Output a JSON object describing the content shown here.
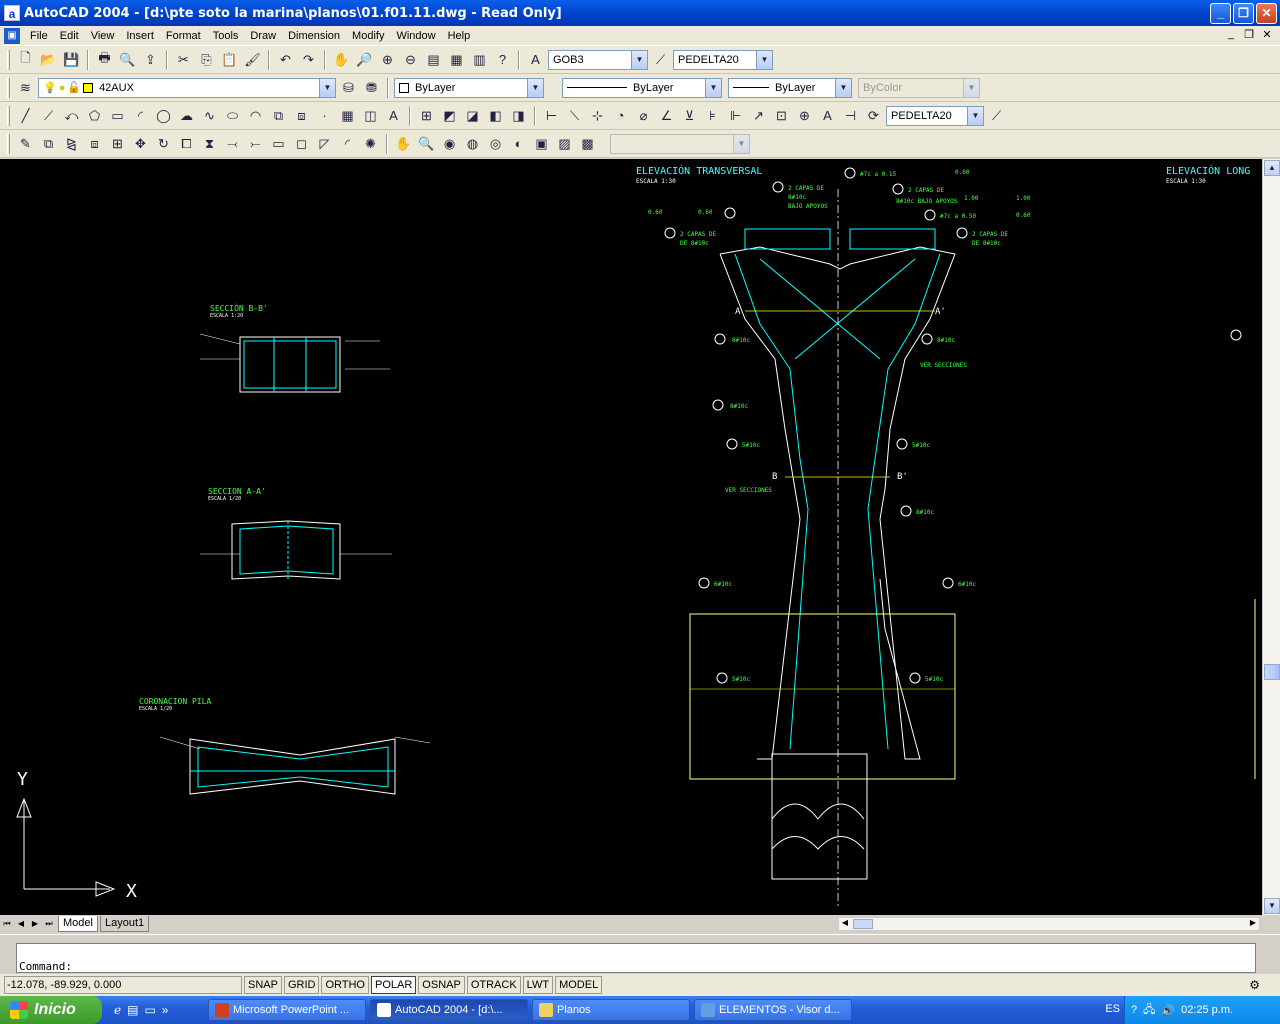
{
  "window": {
    "title": "AutoCAD 2004 - [d:\\pte soto la marina\\planos\\01.f01.11.dwg - Read Only]",
    "app_icon": "a",
    "minimize": "_",
    "maximize": "❐",
    "close": "✕"
  },
  "menu": {
    "items": [
      "File",
      "Edit",
      "View",
      "Insert",
      "Format",
      "Tools",
      "Draw",
      "Dimension",
      "Modify",
      "Window",
      "Help"
    ]
  },
  "toolbar1": {
    "text_style": "GOB3",
    "dim_style": "PEDELTA20"
  },
  "toolbar2": {
    "layer": "42AUX",
    "color": "ByLayer",
    "linetype": "ByLayer",
    "lineweight": "ByLayer",
    "plotstyle": "ByColor"
  },
  "toolbar3": {
    "dim_style": "PEDELTA20"
  },
  "drawing": {
    "elev_trans_title": "ELEVACIÓN TRANSVERSAL",
    "elev_trans_scale": "ESCALA 1:30",
    "elev_long_title": "ELEVACIÓN LONG",
    "elev_long_scale": "ESCALA 1:30",
    "sec_bb_title": "SECCIÓN B-B'",
    "sec_bb_scale": "ESCALA 1:20",
    "sec_aa_title": "SECCION A-A'",
    "sec_aa_scale": "ESCALA 1/20",
    "coron_title": "CORONACION PILA",
    "coron_scale": "ESCALA 1/20",
    "label_a": "A",
    "label_a2": "A'",
    "label_b": "B",
    "label_b2": "B'",
    "ver_secciones": "VER SECCIONES",
    "callouts_left": [
      "2 CAPAS DE",
      "DE 8#10c",
      "8#10c",
      "8#10c",
      "5#10c",
      "6#10c",
      "5#10c"
    ],
    "callouts_right": [
      "2 CAPAS DE",
      "DE 8#10c",
      "8#10c",
      "5#10c",
      "8#10c",
      "6#10c",
      "5#10c"
    ],
    "top_notes": [
      "#7c a 0.15",
      "2 CAPAS DE",
      "8#10c",
      "BAJO APOYOS",
      "2 CAPAS DE",
      "8#10c BAJO APOYOS",
      "#7c a 0.50"
    ],
    "dims": [
      "0.60",
      "0.60",
      "1.00",
      "0.60",
      "0.60",
      "1.00"
    ],
    "ucs_x": "X",
    "ucs_y": "Y"
  },
  "tabs": {
    "model": "Model",
    "layout": "Layout1"
  },
  "command": {
    "prompt": "Command:"
  },
  "status": {
    "coords": "-12.078, -89.929, 0.000",
    "buttons": [
      "SNAP",
      "GRID",
      "ORTHO",
      "POLAR",
      "OSNAP",
      "OTRACK",
      "LWT",
      "MODEL"
    ]
  },
  "taskbar": {
    "start": "Inicio",
    "tasks": [
      "Microsoft PowerPoint ...",
      "AutoCAD 2004 - [d:\\...",
      "Planos",
      "ELEMENTOS - Visor d..."
    ],
    "lang": "ES",
    "time": "02:25 p.m."
  }
}
